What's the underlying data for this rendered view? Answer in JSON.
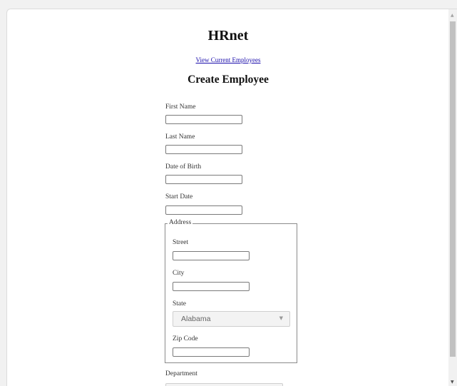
{
  "page": {
    "title": "HRnet",
    "nav_link": "View Current Employees",
    "heading": "Create Employee"
  },
  "form": {
    "first_name": {
      "label": "First Name",
      "value": ""
    },
    "last_name": {
      "label": "Last Name",
      "value": ""
    },
    "date_of_birth": {
      "label": "Date of Birth",
      "value": ""
    },
    "start_date": {
      "label": "Start Date",
      "value": ""
    },
    "address": {
      "legend": "Address",
      "street": {
        "label": "Street",
        "value": ""
      },
      "city": {
        "label": "City",
        "value": ""
      },
      "state": {
        "label": "State",
        "selected": "Alabama"
      },
      "zip_code": {
        "label": "Zip Code",
        "value": ""
      }
    },
    "department": {
      "label": "Department"
    }
  },
  "icons": {
    "select_arrow": "chevron-down-icon",
    "scroll_up": "scroll-up-arrow-icon",
    "scroll_down": "scroll-down-arrow-icon"
  },
  "colors": {
    "link": "#1a0dab",
    "background": "#ffffff",
    "input_border": "#7a7a7a",
    "select_background": "#f3f3f3"
  }
}
